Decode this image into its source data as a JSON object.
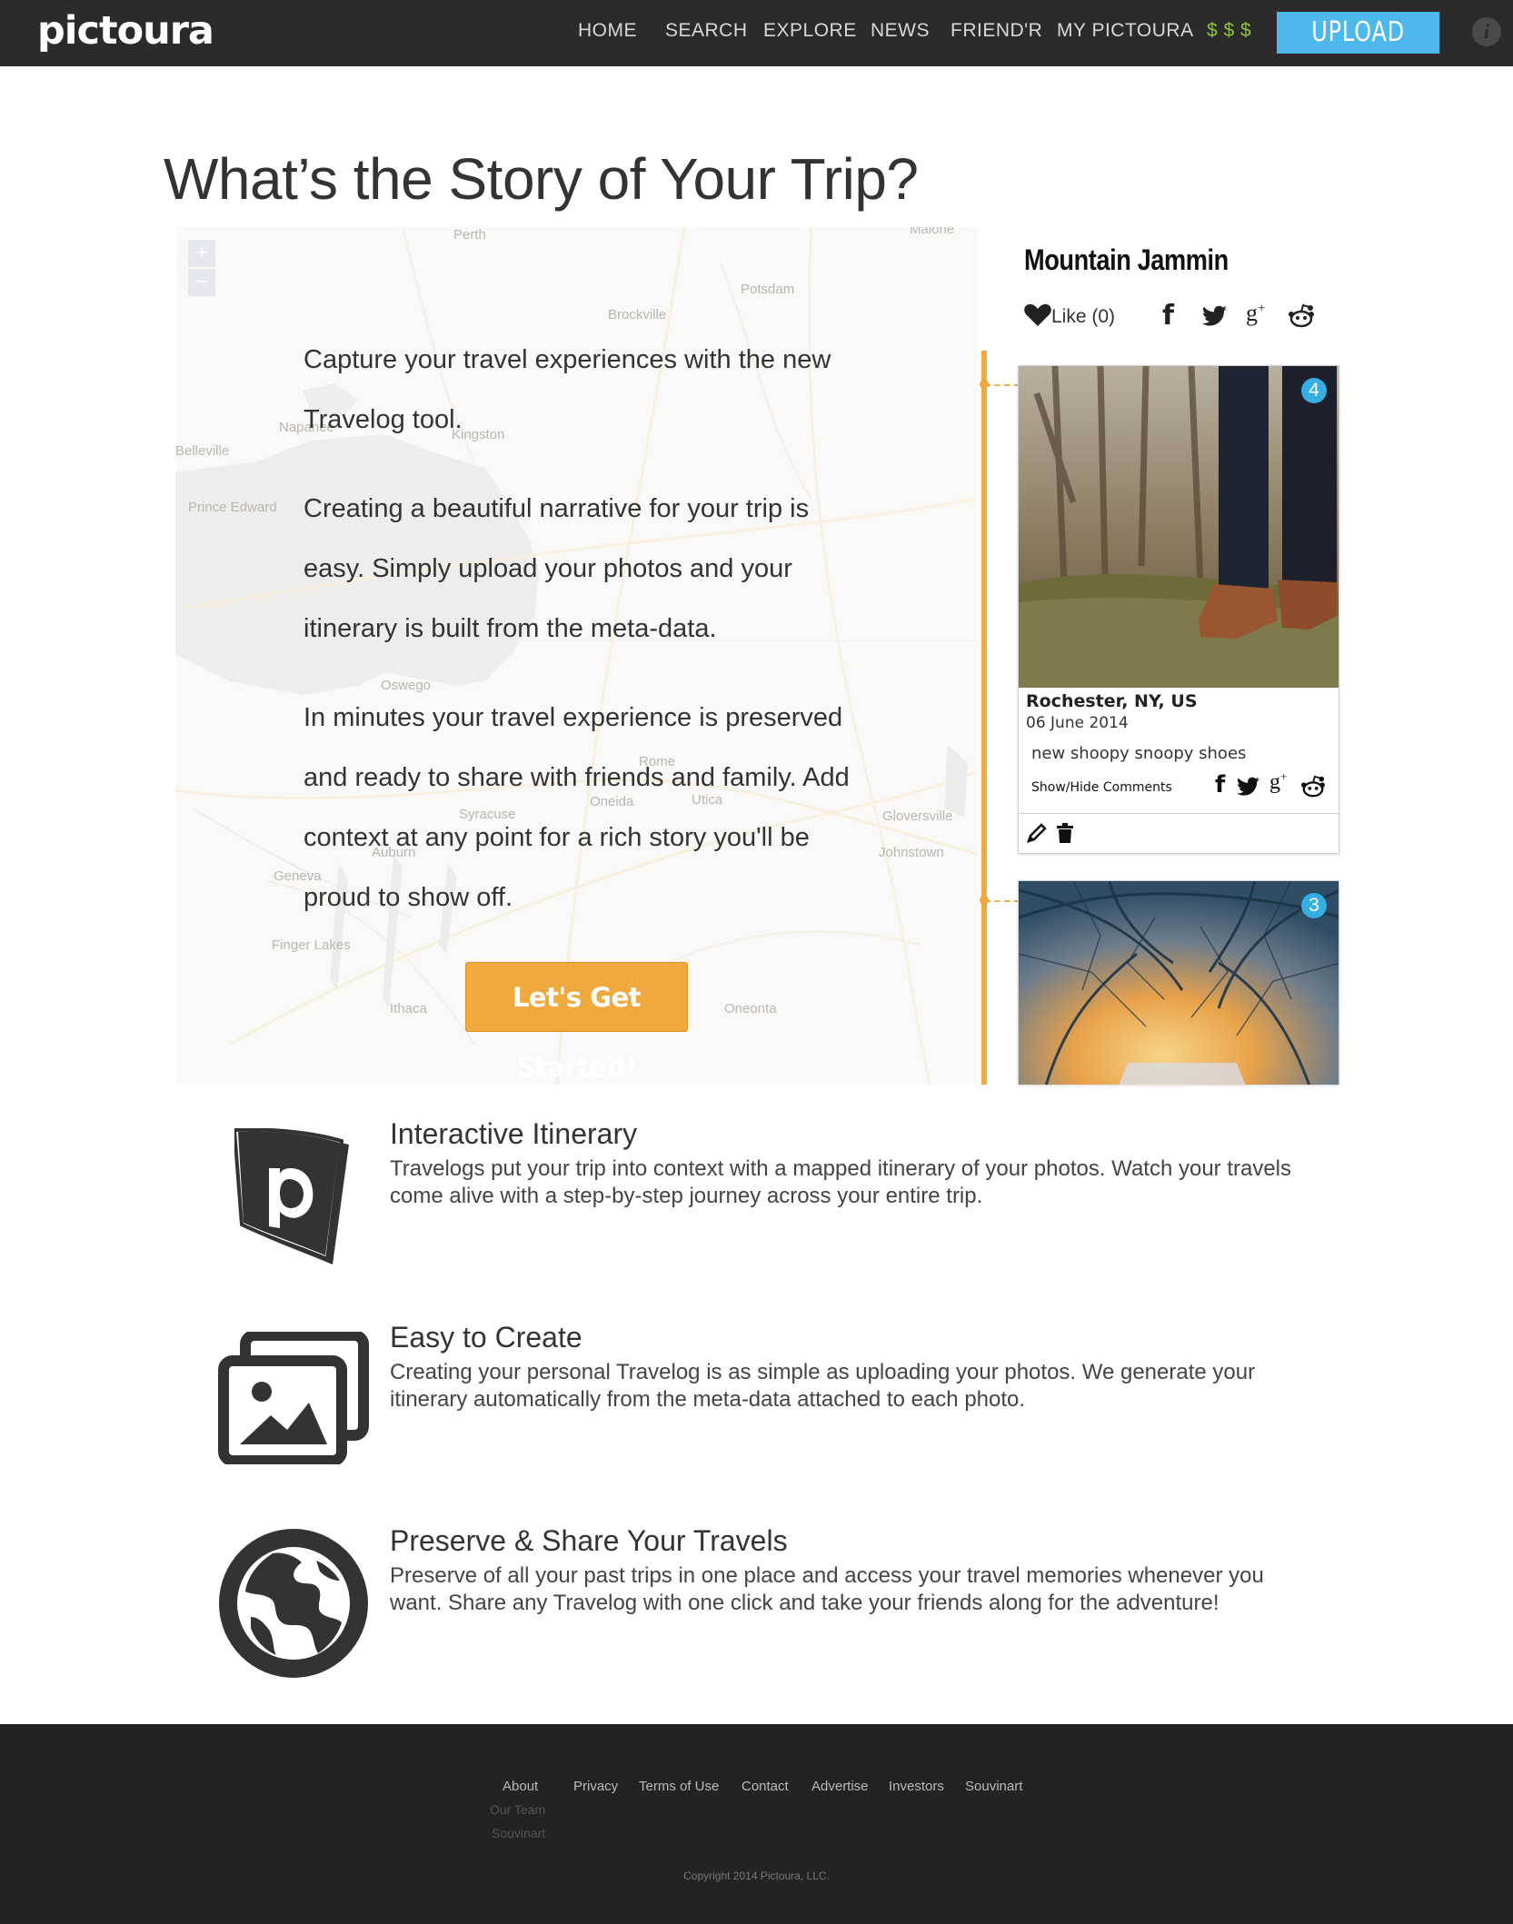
{
  "nav": {
    "logo": "pictoura",
    "items": [
      "HOME",
      "SEARCH",
      "EXPLORE",
      "NEWS",
      "FRIEND'R",
      "MY PICTOURA"
    ],
    "money": "$ $ $",
    "upload": "UPLOAD"
  },
  "page_title": "What’s the Story of Your Trip?",
  "intro": {
    "p1": "Capture your travel experiences with the new Travelog tool.",
    "p2": "Creating a beautiful narrative for your trip is easy. Simply upload your photos and your itinerary is built from the meta-data.",
    "p3": "In minutes your travel experience is preserved and ready to share with friends and family. Add context at any point for a rich story you'll be proud to show off.",
    "cta": "Let's Get Started!"
  },
  "map": {
    "zoom_in": "+",
    "zoom_out": "−",
    "places": [
      "Perth",
      "Potsdam",
      "Brockville",
      "Belleville",
      "Prince Edward",
      "Oswego",
      "Syracuse",
      "Oneida",
      "Utica",
      "Rome",
      "Auburn",
      "Geneva",
      "Ithaca",
      "Oneonta",
      "Gloversville",
      "Johnstown",
      "Finger Lakes",
      "Malone",
      "Napanee",
      "Kingston"
    ]
  },
  "travelog": {
    "title": "Mountain Jammin",
    "like": "Like (0)",
    "cards": [
      {
        "badge": "4",
        "location": "Rochester, NY, US",
        "date": "06 June 2014",
        "caption": "new shoopy snoopy shoes",
        "comments": "Show/Hide Comments"
      },
      {
        "badge": "3"
      }
    ]
  },
  "features": [
    {
      "icon": "pictoura-book-icon",
      "title": "Interactive Itinerary",
      "text": "Travelogs put your trip into context with a mapped itinerary of your photos. Watch your travels come alive with a step-by-step journey across your entire trip."
    },
    {
      "icon": "photos-icon",
      "title": "Easy to Create",
      "text": "Creating your personal Travelog is as simple as uploading your photos. We generate your itinerary automatically from the meta-data attached to each photo."
    },
    {
      "icon": "globe-icon",
      "title": "Preserve & Share Your Travels",
      "text": "Preserve of all your past trips in one place and access your travel memories whenever you want. Share any Travelog with one click and take your friends along for the adventure!"
    }
  ],
  "footer": {
    "links": [
      "About",
      "Privacy",
      "Terms of Use",
      "Contact",
      "Advertise",
      "Investors",
      "Souvinart"
    ],
    "about_sub": [
      "Our Team",
      "Souvinart"
    ],
    "copyright": "Copyright 2014 Pictoura, LLC."
  },
  "colors": {
    "nav_bg": "#2b2b2b",
    "upload": "#4db8ec",
    "accent_orange": "#f0a93e",
    "money_green": "#8fc23e",
    "badge_blue": "#35aee3",
    "footer_bg": "#232323"
  }
}
